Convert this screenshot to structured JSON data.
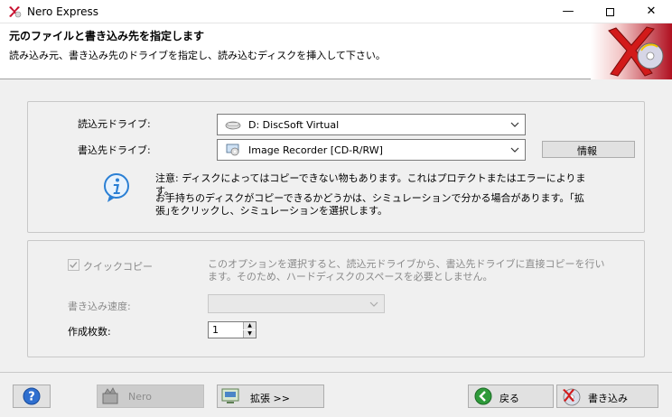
{
  "window": {
    "title": "Nero Express",
    "min_glyph": "—",
    "close_glyph": "✕"
  },
  "header": {
    "title": "元のファイルと書き込み先を指定します",
    "subtitle": "読み込み元、書き込み先のドライブを指定し、読み込むディスクを挿入して下さい。"
  },
  "drives": {
    "source_label": "読込元ドライブ:",
    "source_value": "D: DiscSoft Virtual",
    "target_label": "書込先ドライブ:",
    "target_value": "Image Recorder    [CD-R/RW]",
    "info_button": "情報"
  },
  "notes": {
    "line1": "注意: ディスクによってはコピーできない物もあります。これはプロテクトまたはエラーによります。",
    "line2": "お手持ちのディスクがコピーできるかどうかは、シミュレーションで分かる場合があります。｢拡張｣をクリックし、シミュレーションを選択します。"
  },
  "options": {
    "quick_copy_label": "クイックコピー",
    "quick_copy_checked": true,
    "quick_copy_desc": "このオプションを選択すると、読込元ドライブから、書込先ドライブに直接コピーを行います。そのため、ハードディスクのスペースを必要としません。",
    "speed_label": "書き込み速度:",
    "speed_value": "",
    "copies_label": "作成枚数:",
    "copies_value": "1"
  },
  "footer": {
    "nero_button": "Nero",
    "expand_button": "拡張 >>",
    "back_button": "戻る",
    "burn_button": "書き込み"
  },
  "colors": {
    "accent_red": "#c8102e",
    "info_blue": "#2a7fd4",
    "back_green": "#2e9a3a"
  }
}
